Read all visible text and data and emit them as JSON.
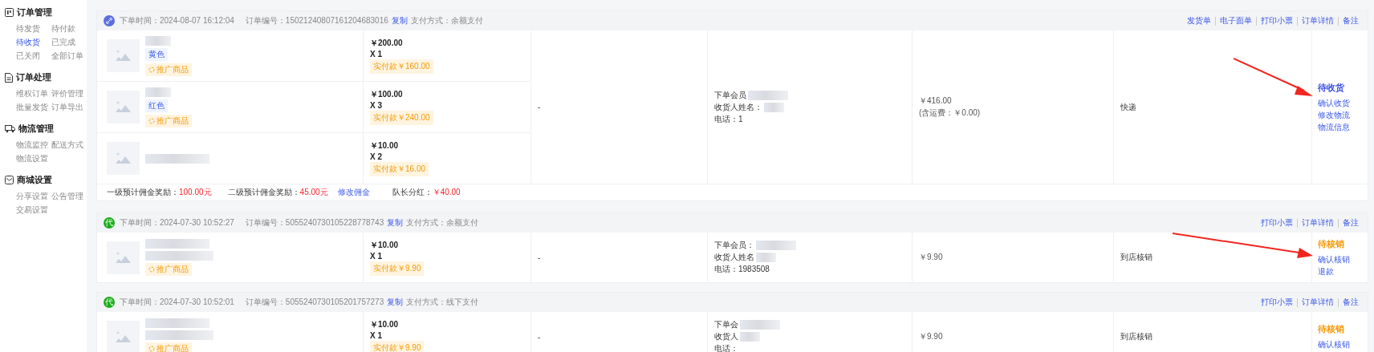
{
  "sidebar": {
    "groups": [
      {
        "title": "订单管理",
        "items": [
          {
            "label": "待发货",
            "selected": false
          },
          {
            "label": "待付款",
            "selected": false
          },
          {
            "label": "待收货",
            "selected": true
          },
          {
            "label": "已完成",
            "selected": false
          },
          {
            "label": "已关闭",
            "selected": false
          },
          {
            "label": "全部订单",
            "selected": false
          }
        ]
      },
      {
        "title": "订单处理",
        "items": [
          {
            "label": "维权订单",
            "selected": false
          },
          {
            "label": "评价管理",
            "selected": false
          },
          {
            "label": "批量发货",
            "selected": false
          },
          {
            "label": "订单导出",
            "selected": false
          }
        ]
      },
      {
        "title": "物流管理",
        "items": [
          {
            "label": "物流监控",
            "selected": false
          },
          {
            "label": "配送方式",
            "selected": false
          },
          {
            "label": "物流设置",
            "selected": false
          }
        ]
      },
      {
        "title": "商城设置",
        "items": [
          {
            "label": "分享设置",
            "selected": false
          },
          {
            "label": "公告管理",
            "selected": false
          },
          {
            "label": "交易设置",
            "selected": false
          }
        ]
      }
    ]
  },
  "orders": [
    {
      "badge": {
        "kind": "icon"
      },
      "time_label": "下单时间：",
      "time": "2024-08-07 16:12:04",
      "number_label": "订单编号：",
      "number": "15021240807161204683016",
      "copy": "复制",
      "pay_label": "支付方式：",
      "pay": "余额支付",
      "actions": [
        "发货单",
        "电子面单",
        "打印小票",
        "订单详情",
        "备注"
      ],
      "items": [
        {
          "spec": "黄色",
          "promo": "推广商品",
          "price": "￥200.00",
          "qty": "X 1",
          "paid": "实付款￥160.00"
        },
        {
          "spec": "红色",
          "promo": "推广商品",
          "price": "￥100.00",
          "qty": "X 3",
          "paid": "实付款￥240.00"
        },
        {
          "price": "￥10.00",
          "qty": "X 2",
          "paid": "实付款￥16.00"
        }
      ],
      "dash": "-",
      "member": [
        "下单会员",
        "收货人姓名：",
        "电话：1"
      ],
      "total": "￥416.00",
      "fee": "(含运费：￥0.00)",
      "delivery": "快递",
      "status": {
        "text": "待收货",
        "color": "#3b4fe0"
      },
      "status_actions": [
        "确认收货",
        "修改物流",
        "物流信息"
      ],
      "arrow": true,
      "commission": {
        "l1_label": "一级预计佣金奖励：",
        "l1": "100.00元",
        "l2_label": "二级预计佣金奖励：",
        "l2": "45.00元",
        "edit": "修改佣金",
        "lead_label": "队长分红：",
        "lead": "￥40.00"
      }
    },
    {
      "badge": {
        "kind": "text",
        "text": "代"
      },
      "time_label": "下单时间：",
      "time": "2024-07-30 10:52:27",
      "number_label": "订单编号：",
      "number": "5055240730105228778743",
      "copy": "复制",
      "pay_label": "支付方式：",
      "pay": "余额支付",
      "actions": [
        "打印小票",
        "订单详情",
        "备注"
      ],
      "items": [
        {
          "promo": "推广商品",
          "price": "￥10.00",
          "qty": "X 1",
          "paid": "实付款￥9.90"
        }
      ],
      "dash": "-",
      "member": [
        "下单会员：",
        "收货人姓名",
        "电话：1983508"
      ],
      "total": "￥9.90",
      "delivery": "到店核销",
      "status": {
        "text": "待核销",
        "color": "#f59a0a"
      },
      "status_actions": [
        "确认核销",
        "退款"
      ],
      "arrow": true
    },
    {
      "badge": {
        "kind": "text",
        "text": "代"
      },
      "time_label": "下单时间：",
      "time": "2024-07-30 10:52:01",
      "number_label": "订单编号：",
      "number": "5055240730105201757273",
      "copy": "复制",
      "pay_label": "支付方式：",
      "pay": "线下支付",
      "actions": [
        "打印小票",
        "订单详情",
        "备注"
      ],
      "items": [
        {
          "promo": "推广商品",
          "price": "￥10.00",
          "qty": "X 1",
          "paid": "实付款￥9.90"
        }
      ],
      "dash": "-",
      "member": [
        "下单会",
        "收货人",
        "电话："
      ],
      "total": "￥9.90",
      "delivery": "到店核销",
      "status": {
        "text": "待核销",
        "color": "#f59a0a"
      },
      "status_actions": [
        "确认核销"
      ],
      "arrow": false
    }
  ]
}
